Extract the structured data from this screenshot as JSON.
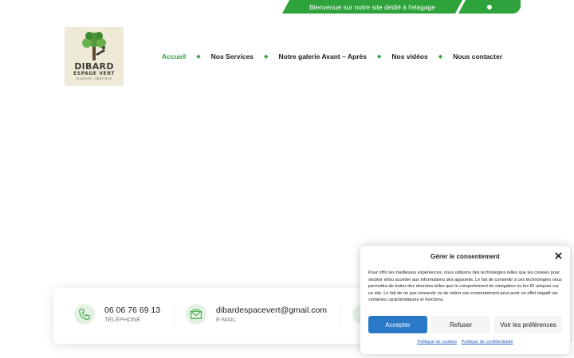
{
  "banner": {
    "text": "Bienvenue sur notre site dédié à l'elagage",
    "social_icon": "facebook-icon"
  },
  "logo": {
    "name": "DIBARD",
    "sub": "ESPAGE VERT",
    "tagline": "ÉLAGAGE • ABATTAGE"
  },
  "nav": {
    "items": [
      {
        "label": "Accueil",
        "active": true
      },
      {
        "label": "Nos Services",
        "active": false
      },
      {
        "label": "Notre galerie Avant – Après",
        "active": false
      },
      {
        "label": "Nos vidéos",
        "active": false
      },
      {
        "label": "Nous contacter",
        "active": false
      }
    ],
    "separator": "◆"
  },
  "contact": {
    "phone": {
      "value": "06 06 76 69 13",
      "label": "TÉLÉPHONE",
      "icon": "phone-icon"
    },
    "email": {
      "value": "dibardespacevert@gmail.com",
      "label": "E-MAIL",
      "icon": "mail-icon"
    }
  },
  "consent": {
    "title": "Gérer le consentement",
    "body": "Pour offrir les meilleures expériences, nous utilisons des technologies telles que les cookies pour stocker et/ou accéder aux informations des appareils. Le fait de consentir à ces technologies nous permettra de traiter des données telles que le comportement de navigation ou les ID uniques sur ce site. Le fait de ne pas consentir ou de retirer son consentement peut avoir un effet négatif sur certaines caractéristiques et fonctions.",
    "accept": "Accepter",
    "refuse": "Refuser",
    "preferences": "Voir les préférences",
    "cookie_policy": "Politique de cookies",
    "privacy_policy": "Politique de confidentialité"
  },
  "colors": {
    "brand_green": "#2fa33b",
    "accept_blue": "#2a79c7",
    "logo_bg": "#efe9d7"
  }
}
